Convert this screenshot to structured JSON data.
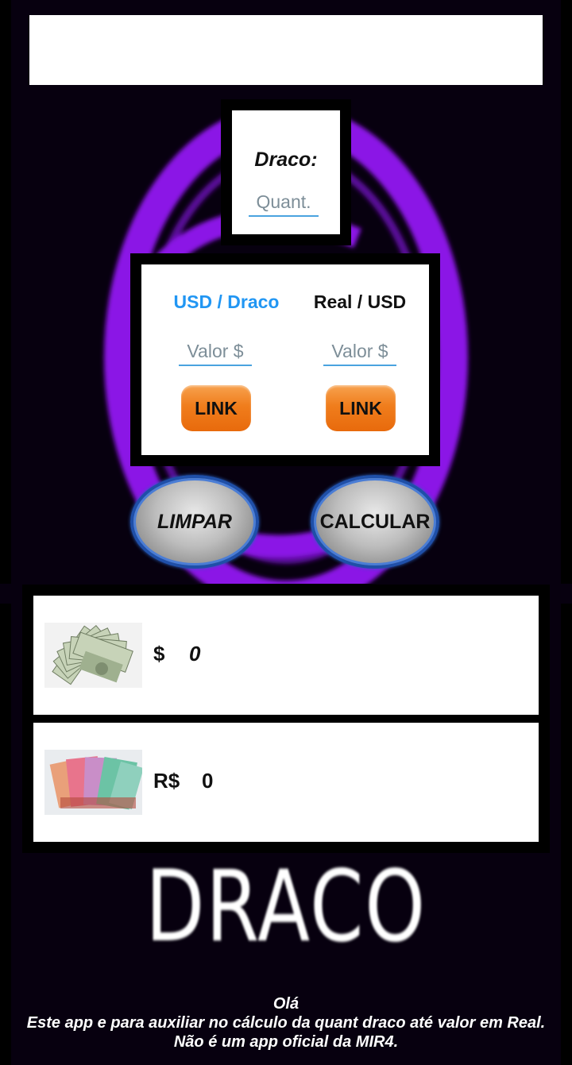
{
  "ad_banner": {},
  "draco_input": {
    "label": "Draco:",
    "placeholder": "Quant.",
    "value": ""
  },
  "rates": {
    "usd_draco": {
      "title": "USD / Draco",
      "placeholder": "Valor $",
      "value": "",
      "link_label": "LINK"
    },
    "real_usd": {
      "title": "Real / USD",
      "placeholder": "Valor $",
      "value": "",
      "link_label": "LINK"
    }
  },
  "buttons": {
    "clear_label": "LIMPAR",
    "calculate_label": "CALCULAR"
  },
  "results": {
    "usd": {
      "symbol": "$",
      "value": "0",
      "icon": "dollar-bills-image"
    },
    "brl": {
      "symbol": "R$",
      "value": "0",
      "icon": "real-bills-image"
    }
  },
  "logo_text": "DRACO",
  "footer": {
    "line1": "Olá",
    "line2": "Este app e para auxiliar no cálculo da quant draco até valor em Real.",
    "line3": "Não é um app oficial da MIR4."
  },
  "colors": {
    "background": "#07000f",
    "accent_purple": "#8b14e6",
    "link_orange": "#f07d1c",
    "usd_title_blue": "#2196f3"
  }
}
